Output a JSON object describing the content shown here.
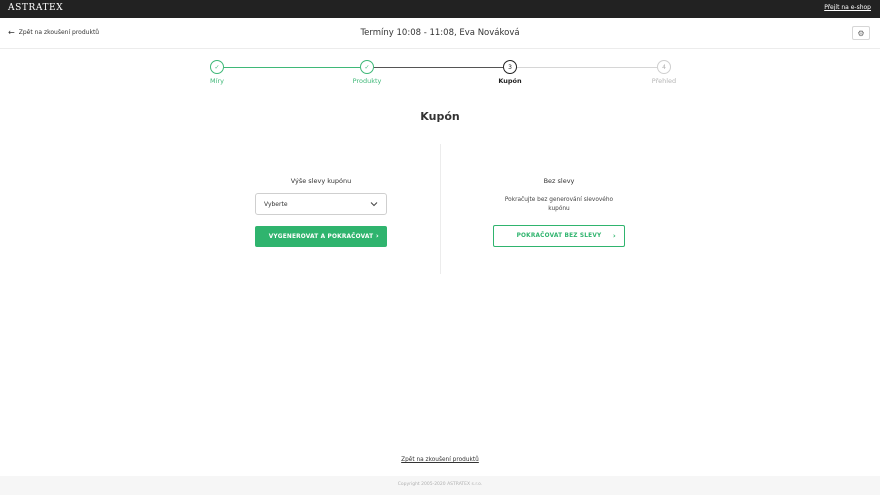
{
  "topbar": {
    "brand": "ASTRATEX",
    "eshop_link": "Přejít na e-shop"
  },
  "header": {
    "back_label": "Zpět na zkoušení produktů",
    "title": "Termíny 10:08 - 11:08, Eva Nováková",
    "settings_icon": "gear-icon"
  },
  "stepper": {
    "steps": [
      {
        "label": "Míry",
        "marker": "✓",
        "state": "done"
      },
      {
        "label": "Produkty",
        "marker": "✓",
        "state": "done"
      },
      {
        "label": "Kupón",
        "marker": "3",
        "state": "active"
      },
      {
        "label": "Přehled",
        "marker": "4",
        "state": "todo"
      }
    ]
  },
  "section_title": "Kupón",
  "left": {
    "label": "Výše slevy kupónu",
    "select_value": "Vyberte",
    "button_label": "VYGENEROVAT A POKRAČOVAT"
  },
  "right": {
    "label": "Bez slevy",
    "description_line1": "Pokračujte bez generování slevového",
    "description_line2": "kupónu",
    "button_label": "POKRAČOVAT BEZ SLEVY"
  },
  "bottom_link": "Zpět na zkoušení produktů",
  "footer": {
    "copyright": "Copyright 2005-2020 ASTRATEX s.r.o."
  },
  "colors": {
    "accent": "#2fb46e",
    "topbar": "#222222",
    "done": "#3fb878"
  }
}
